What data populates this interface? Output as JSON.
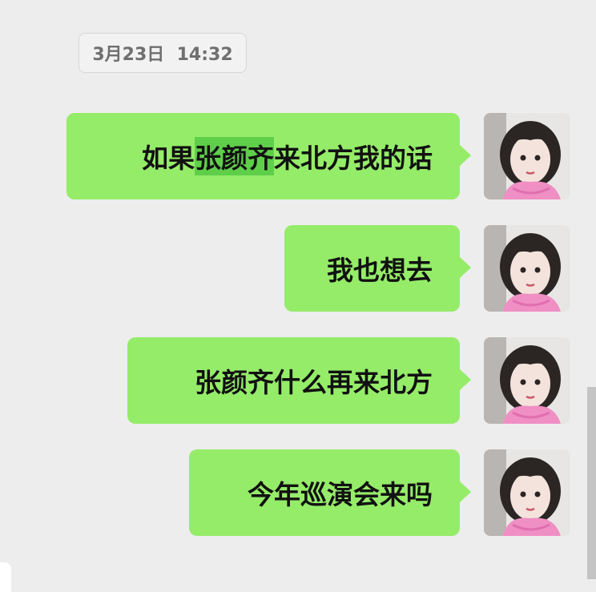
{
  "timestamp": "3月23日  14:32",
  "messages": [
    {
      "pre": "如果",
      "highlight": "张颜齐",
      "post": "来北方我的话"
    },
    {
      "pre": "我也想去",
      "highlight": "",
      "post": ""
    },
    {
      "pre": "张颜齐什么再来北方",
      "highlight": "",
      "post": ""
    },
    {
      "pre": "今年巡演会来吗",
      "highlight": "",
      "post": ""
    }
  ],
  "colors": {
    "background": "#ededed",
    "bubble": "#95ec69",
    "highlight": "#5fcf4a",
    "text": "#111111"
  }
}
